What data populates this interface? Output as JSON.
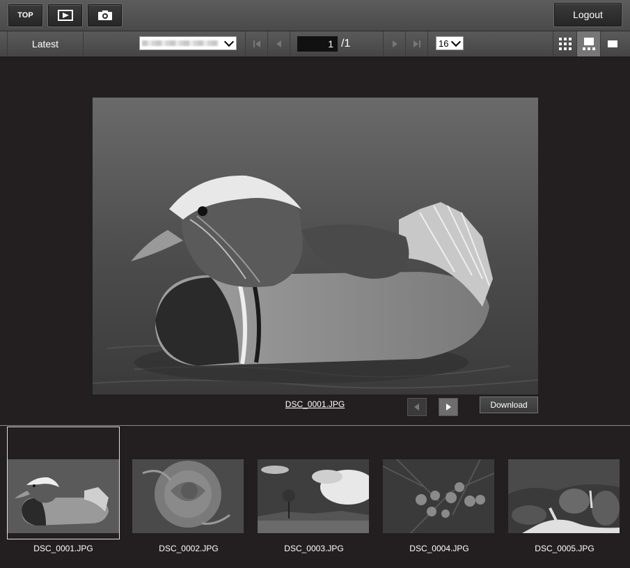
{
  "header": {
    "top_label": "TOP",
    "logout_label": "Logout",
    "play_icon": "playback-icon",
    "camera_icon": "camera-icon"
  },
  "toolbar": {
    "latest_label": "Latest",
    "folder_value": "",
    "page_current": "1",
    "page_total": "/1",
    "per_page": "16",
    "view_modes": [
      "grid-view-icon",
      "thumbnail-strip-view-icon",
      "single-view-icon"
    ],
    "active_view": "thumbnail-strip-view-icon"
  },
  "viewer": {
    "filename": "DSC_0001.JPG",
    "download_label": "Download"
  },
  "thumbnails": [
    {
      "filename": "DSC_0001.JPG",
      "selected": true
    },
    {
      "filename": "DSC_0002.JPG",
      "selected": false
    },
    {
      "filename": "DSC_0003.JPG",
      "selected": false
    },
    {
      "filename": "DSC_0004.JPG",
      "selected": false
    },
    {
      "filename": "DSC_0005.JPG",
      "selected": false
    }
  ]
}
